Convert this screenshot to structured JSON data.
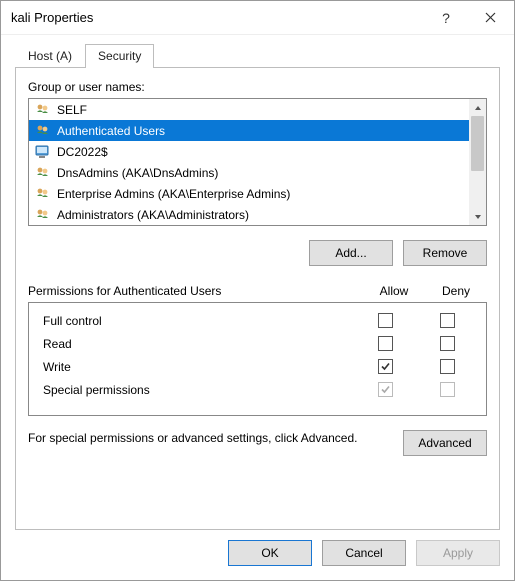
{
  "window": {
    "title": "kali Properties"
  },
  "tabs": {
    "host": "Host (A)",
    "security": "Security"
  },
  "groupLabel": "Group or user names:",
  "users": [
    {
      "name": "SELF",
      "iconType": "group"
    },
    {
      "name": "Authenticated Users",
      "iconType": "group",
      "selected": true
    },
    {
      "name": "DC2022$",
      "iconType": "computer"
    },
    {
      "name": "DnsAdmins (AKA\\DnsAdmins)",
      "iconType": "group"
    },
    {
      "name": "Enterprise Admins (AKA\\Enterprise Admins)",
      "iconType": "group"
    },
    {
      "name": "Administrators (AKA\\Administrators)",
      "iconType": "group"
    }
  ],
  "buttons": {
    "add": "Add...",
    "remove": "Remove",
    "advanced": "Advanced",
    "ok": "OK",
    "cancel": "Cancel",
    "apply": "Apply"
  },
  "permHeader": {
    "title": "Permissions for Authenticated Users",
    "allow": "Allow",
    "deny": "Deny"
  },
  "permissions": [
    {
      "name": "Full control",
      "allow": false,
      "deny": false,
      "disabled": false
    },
    {
      "name": "Read",
      "allow": false,
      "deny": false,
      "disabled": false
    },
    {
      "name": "Write",
      "allow": true,
      "deny": false,
      "disabled": false
    },
    {
      "name": "Special permissions",
      "allow": true,
      "deny": false,
      "disabled": true
    }
  ],
  "advancedNote": "For special permissions or advanced settings, click Advanced."
}
